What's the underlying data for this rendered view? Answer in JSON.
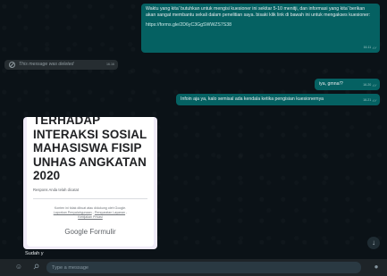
{
  "messages": {
    "msg1": {
      "text": "Waktu yang kita' butuhkan untuk mengisi kuesioner ini sekitar 5-10 menitji, dan informasi yang kita' berikan akan sangat membantu sekali dalam penelitian saya. bisaki klik link di bawah ini untuk mengakses kuesioner:",
      "link": "https://forms.gle/2D6yC3GgSWWZS7S38",
      "time": "16.11"
    },
    "deleted": {
      "text": "This message was deleted",
      "time": "16.16"
    },
    "msg2": {
      "text": "iya, gmna!?",
      "time": "16.20"
    },
    "msg3": {
      "text": "Infoin aja ya, kalo semisal ada kendala ketika pengisian kuesionernya",
      "time": "16.21"
    }
  },
  "form_preview": {
    "title_lines": [
      "TERHADAP",
      "INTERAKSI SOSIAL",
      "MAHASISWA FISIP",
      "UNHAS ANGKATAN",
      "2020"
    ],
    "note": "Respons Anda telah dicatat",
    "footer_line1": "Konten ini tidak dibuat atau didukung oleh Google.",
    "footer_link1": "Laporkan Penyalahgunaan",
    "footer_sep1": " - ",
    "footer_link2": "Persyaratan Layanan",
    "footer_sep2": " - ",
    "footer_link3": "Kebijakan Privasi",
    "logo": "Google Formulir"
  },
  "reply": {
    "text": "Sudah y"
  },
  "compose": {
    "placeholder": "Type a message"
  },
  "icons": {
    "emoji": "emoji-icon",
    "attach": "paperclip-icon",
    "mic": "microphone-icon",
    "scroll": "arrow-down-icon"
  },
  "colors": {
    "outgoing_bubble": "#056162",
    "incoming_bubble": "#262d31",
    "background": "#0b1217",
    "compose_bar": "#1e2428"
  }
}
